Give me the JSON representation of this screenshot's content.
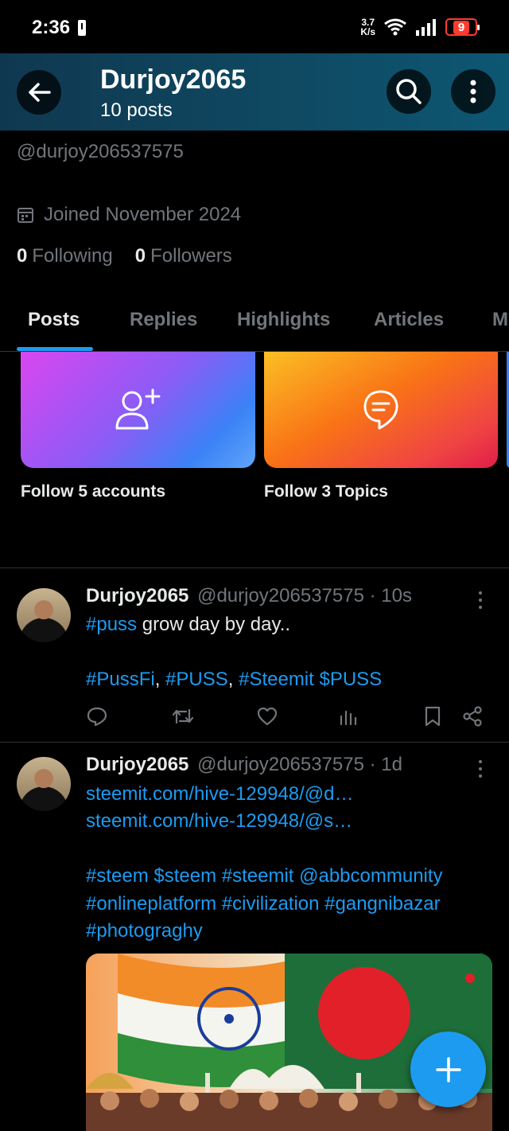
{
  "status_bar": {
    "time": "2:36",
    "net_speed_value": "3.7",
    "net_speed_unit": "K/s",
    "battery": "9"
  },
  "header": {
    "title": "Durjoy2065",
    "subtitle": "10 posts"
  },
  "profile": {
    "handle": "@durjoy206537575",
    "joined": "Joined November 2024",
    "following_count": "0",
    "following_label": "Following",
    "followers_count": "0",
    "followers_label": "Followers"
  },
  "tabs": [
    {
      "label": "Posts",
      "active": true
    },
    {
      "label": "Replies",
      "active": false
    },
    {
      "label": "Highlights",
      "active": false
    },
    {
      "label": "Articles",
      "active": false
    },
    {
      "label": "M",
      "active": false
    }
  ],
  "suggestions": [
    {
      "label": "Follow 5 accounts",
      "icon": "add-user-icon"
    },
    {
      "label": "Follow 3 Topics",
      "icon": "topic-bubble-icon"
    }
  ],
  "posts": [
    {
      "name": "Durjoy2065",
      "handle": "@durjoy206537575",
      "time": "· 10s",
      "line1_tag": "#puss",
      "line1_text": " grow day by day..",
      "tag1": "#PussFi",
      "sep1": ", ",
      "tag2": "#PUSS",
      "sep2": ", ",
      "tag3": "#Steemit $PUSS"
    },
    {
      "name": "Durjoy2065",
      "handle": "@durjoy206537575",
      "time": "· 1d",
      "link1": "steemit.com/hive-129948/@d…",
      "link2": "steemit.com/hive-129948/@s…",
      "tags1": "#steem $steem #steemit @abbcommunity",
      "tags2": "#onlineplatform #civilization #gangnibazar",
      "tags3": "#photograghy"
    }
  ],
  "colors": {
    "accent": "#1d9bf0",
    "muted": "#71767b",
    "text": "#e7e9ea",
    "header_bg": "#0f4a63"
  }
}
